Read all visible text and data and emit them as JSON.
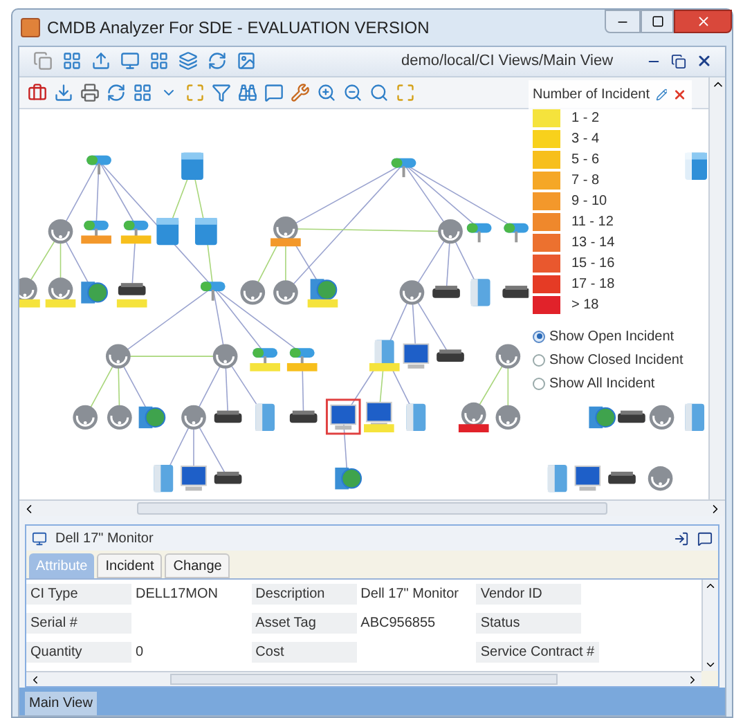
{
  "window": {
    "title": "CMDB Analyzer For SDE - EVALUATION VERSION"
  },
  "view_header": {
    "path": "demo/local/CI Views/Main View"
  },
  "legend": {
    "title": "Number of Incident",
    "items": [
      {
        "label": "1 - 2",
        "color": "#f5e33c"
      },
      {
        "label": "3 - 4",
        "color": "#f8d11c"
      },
      {
        "label": "5 - 6",
        "color": "#f7bf1c"
      },
      {
        "label": "7 - 8",
        "color": "#f5a726"
      },
      {
        "label": "9 - 10",
        "color": "#f3982b"
      },
      {
        "label": "11 - 12",
        "color": "#ef882c"
      },
      {
        "label": "13 - 14",
        "color": "#ec712f"
      },
      {
        "label": "15 - 16",
        "color": "#e9582e"
      },
      {
        "label": "17 - 18",
        "color": "#e53b25"
      },
      {
        "label": "> 18",
        "color": "#e1222a"
      }
    ],
    "options": [
      {
        "label": "Show Open Incident",
        "selected": true
      },
      {
        "label": "Show Closed Incident",
        "selected": false
      },
      {
        "label": "Show All Incident",
        "selected": false
      }
    ]
  },
  "detail": {
    "title": "Dell 17\" Monitor",
    "tabs": [
      {
        "label": "Attribute",
        "selected": true
      },
      {
        "label": "Incident",
        "selected": false
      },
      {
        "label": "Change",
        "selected": false
      }
    ],
    "rows": [
      [
        {
          "label": "CI Type",
          "value": "DELL17MON"
        },
        {
          "label": "Description",
          "value": "Dell 17\" Monitor"
        },
        {
          "label": "Vendor ID"
        }
      ],
      [
        {
          "label": "Serial #"
        },
        {
          "label": "Asset Tag",
          "value": "ABC956855"
        },
        {
          "label": "Status"
        }
      ],
      [
        {
          "label": "Quantity",
          "value": "0"
        },
        {
          "label": "Cost"
        },
        {
          "label": "Service Contract #"
        }
      ]
    ]
  },
  "status_tabs": [
    {
      "label": "Main View",
      "selected": true
    }
  ]
}
